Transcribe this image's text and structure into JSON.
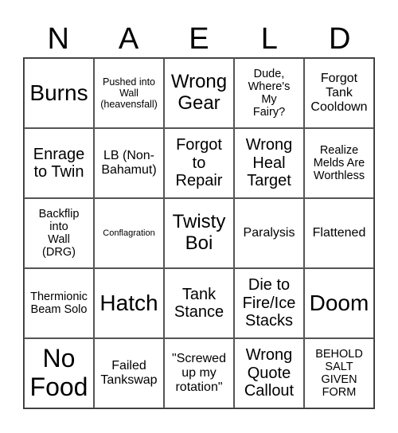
{
  "header": [
    "N",
    "A",
    "E",
    "L",
    "D"
  ],
  "cells": [
    [
      "Burns",
      "Pushed into Wall (heavensfall)",
      "Wrong Gear",
      "Dude, Where's My Fairy?",
      "Forgot Tank Cooldown"
    ],
    [
      "Enrage to Twin",
      "LB (Non-Bahamut)",
      "Forgot to Repair",
      "Wrong Heal Target",
      "Realize Melds Are Worthless"
    ],
    [
      "Backflip into Wall (DRG)",
      "Conflagration",
      "Twisty Boi",
      "Paralysis",
      "Flattened"
    ],
    [
      "Thermionic Beam Solo",
      "Hatch",
      "Tank Stance",
      "Die to Fire/Ice Stacks",
      "Doom"
    ],
    [
      "No Food",
      "Failed Tankswap",
      "\"Screwed up my rotation\"",
      "Wrong Quote Callout",
      "BEHOLD SALT GIVEN FORM"
    ]
  ]
}
